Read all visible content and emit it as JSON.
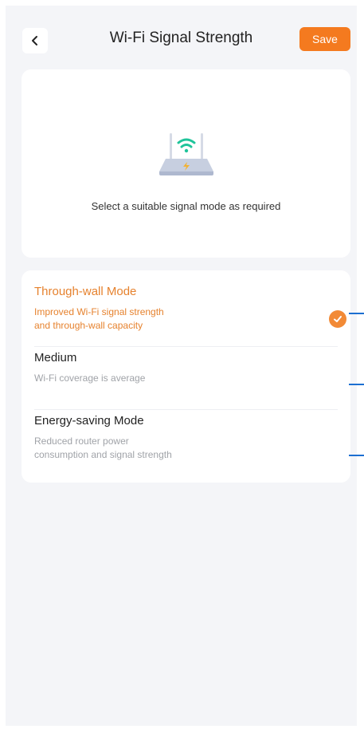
{
  "header": {
    "title": "Wi-Fi Signal Strength",
    "save_label": "Save",
    "back_icon": "chevron-left-icon"
  },
  "hero": {
    "illustration": "router-wifi-icon",
    "description": "Select a suitable signal mode as required"
  },
  "options": [
    {
      "title": "Through-wall Mode",
      "desc_line1": "Improved Wi-Fi signal strength",
      "desc_line2": "and through-wall capacity",
      "selected": true
    },
    {
      "title": "Medium",
      "desc_line1": "Wi-Fi coverage is average",
      "desc_line2": "",
      "selected": false
    },
    {
      "title": "Energy-saving Mode",
      "desc_line1": "Reduced router power",
      "desc_line2": "consumption and signal strength",
      "selected": false
    }
  ],
  "colors": {
    "accent": "#f47a1f",
    "selected_text": "#e6822e",
    "background": "#f4f5f8",
    "pointer": "#1c6fd1"
  }
}
